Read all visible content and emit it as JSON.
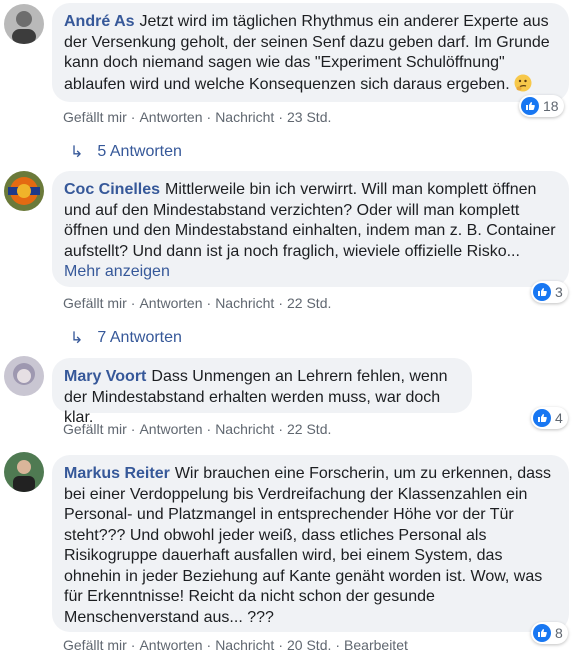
{
  "comments": [
    {
      "name": "André As",
      "text": "Jetzt wird im täglichen Rhythmus ein anderer Experte aus der Versenkung geholt, der seinen Senf dazu geben darf. Im Grunde kann doch niemand sagen wie das \"Experiment Schulöffnung\" ablaufen wird und welche Konsequenzen sich daraus ergeben.",
      "emoji": "thinking-face-icon",
      "like": "Gefällt mir",
      "reply": "Antworten",
      "message": "Nachricht",
      "time": "23 Std.",
      "reactions": "18",
      "replies": "5 Antworten"
    },
    {
      "name": "Coc Cinelles",
      "text": "Mittlerweile bin ich verwirrt. Will man komplett öffnen und auf den Mindestabstand verzichten? Oder will man komplett öffnen und den Mindestabstand einhalten, indem man z. B. Container aufstellt? Und dann ist ja noch fraglich, wieviele offizielle Risko...",
      "more": "Mehr anzeigen",
      "like": "Gefällt mir",
      "reply": "Antworten",
      "message": "Nachricht",
      "time": "22 Std.",
      "reactions": "3",
      "replies": "7 Antworten"
    },
    {
      "name": "Mary Voort",
      "text": "Dass Unmengen an Lehrern fehlen, wenn der Mindestabstand erhalten werden muss, war doch klar.",
      "like": "Gefällt mir",
      "reply": "Antworten",
      "message": "Nachricht",
      "time": "22 Std.",
      "reactions": "4"
    },
    {
      "name": "Markus Reiter",
      "text": "Wir brauchen eine Forscherin, um zu erkennen, dass bei einer Verdoppelung bis Verdreifachung der Klassenzahlen ein Personal- und Platzmangel in entsprechender Höhe vor der Tür steht??? Und obwohl jeder weiß, dass etliches Personal als Risikogruppe dauerhaft ausfallen wird, bei einem System, das ohnehin in jeder Beziehung auf Kante genäht worden ist. Wow, was für Erkenntnisse! Reicht da nicht schon der gesunde Menschenverstand aus... ???",
      "like": "Gefällt mir",
      "reply": "Antworten",
      "message": "Nachricht",
      "time": "20 Std.",
      "edited": "Bearbeitet",
      "reactions": "8"
    }
  ],
  "colors": {
    "name": "#365899",
    "bubble": "#f0f2f5",
    "meta": "#606770",
    "like": "#1877f2"
  },
  "icons": {
    "reply_arrow": "reply-arrow-icon",
    "like": "like-thumb-icon"
  }
}
